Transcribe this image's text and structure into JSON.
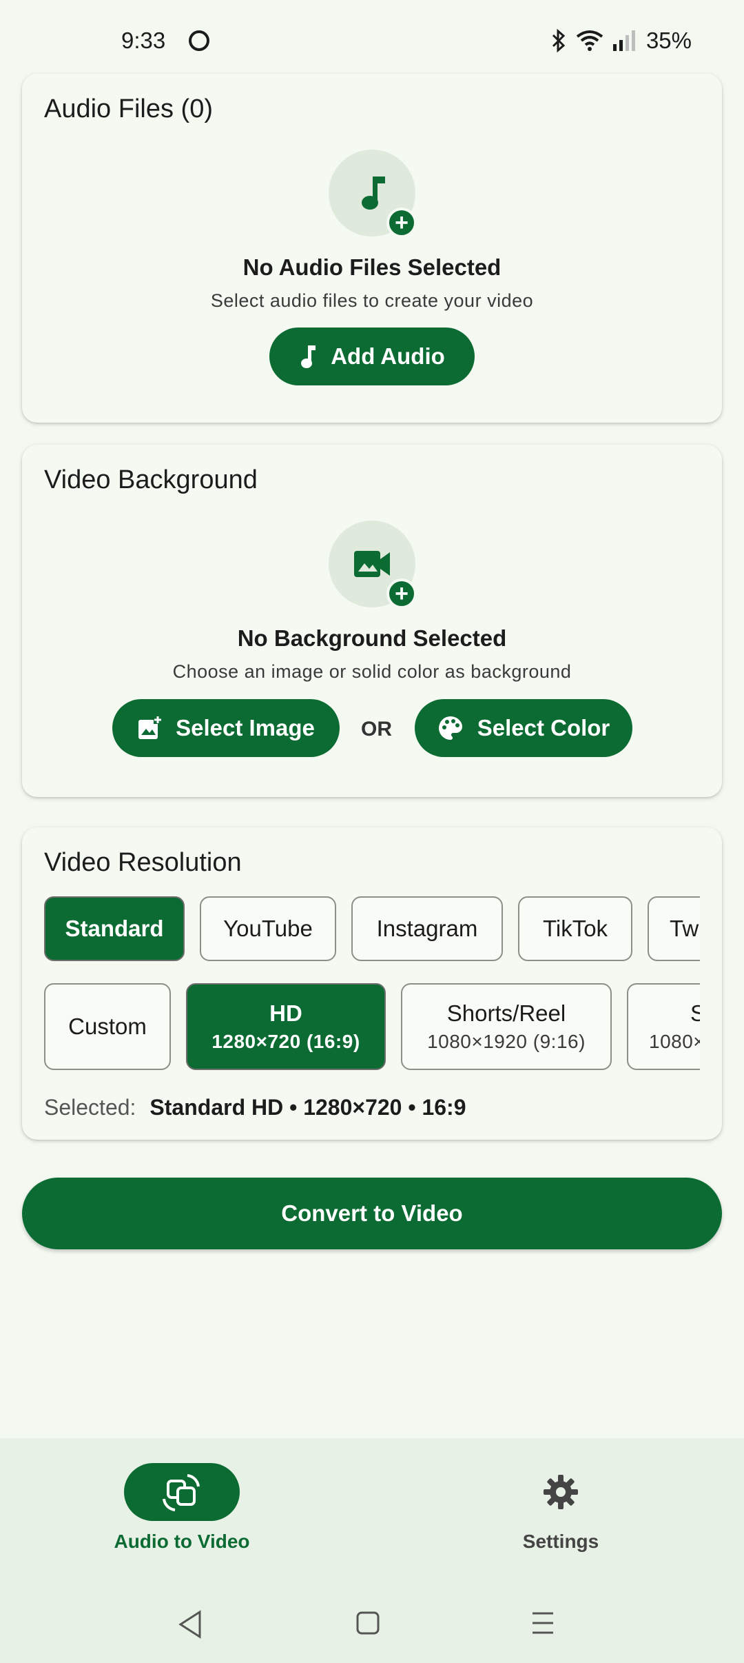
{
  "status_bar": {
    "time": "9:33",
    "battery": "35%",
    "icons": [
      "face-icon",
      "bluetooth-icon",
      "wifi-icon",
      "signal-icon"
    ]
  },
  "audio_card": {
    "title": "Audio Files (0)",
    "icon": "music-note-add-icon",
    "empty_title": "No Audio Files Selected",
    "empty_subtitle": "Select audio files to create your video",
    "add_button": "Add Audio"
  },
  "background_card": {
    "title": "Video Background",
    "icon": "video-add-icon",
    "empty_title": "No Background Selected",
    "empty_subtitle": "Choose an image or solid color as background",
    "select_image_button": "Select Image",
    "or_text": "OR",
    "select_color_button": "Select Color"
  },
  "resolution_card": {
    "title": "Video Resolution",
    "categories": [
      {
        "label": "Standard",
        "selected": true
      },
      {
        "label": "YouTube",
        "selected": false
      },
      {
        "label": "Instagram",
        "selected": false
      },
      {
        "label": "TikTok",
        "selected": false
      },
      {
        "label": "Tw",
        "selected": false
      }
    ],
    "presets": [
      {
        "label": "Custom",
        "sub": "",
        "selected": false
      },
      {
        "label": "HD",
        "sub": "1280×720 (16:9)",
        "selected": true
      },
      {
        "label": "Shorts/Reel",
        "sub": "1080×1920 (9:16)",
        "selected": false
      },
      {
        "label": "S",
        "sub": "1080×",
        "selected": false
      }
    ],
    "selected_label": "Selected:",
    "selected_value": "Standard HD • 1280×720 • 16:9"
  },
  "convert_button": "Convert to Video",
  "bottom_nav": {
    "items": [
      {
        "label": "Audio to Video",
        "icon": "convert-icon",
        "active": true
      },
      {
        "label": "Settings",
        "icon": "gear-icon",
        "active": false
      }
    ]
  },
  "system_nav": [
    "back-icon",
    "home-icon",
    "menu-icon"
  ],
  "colors": {
    "primary": "#0b6b33",
    "background": "#f3f8f0",
    "card": "#f4f9f1",
    "nav_bar": "#e8f1e5"
  }
}
